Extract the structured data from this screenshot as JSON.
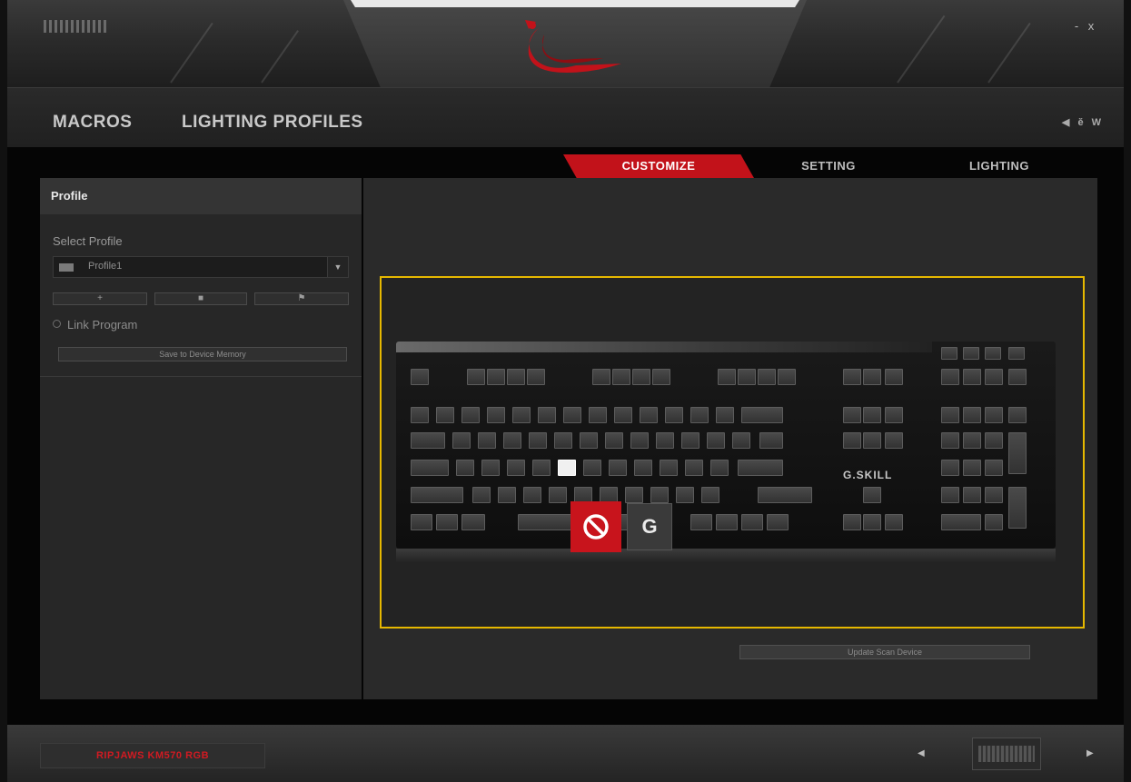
{
  "window": {
    "minimize_label": "-",
    "close_label": "x"
  },
  "nav": {
    "macros": "MACROS",
    "lighting_profiles": "LIGHTING PROFILES",
    "language": "◀ ĕ W"
  },
  "tabs": {
    "customize": "CUSTOMIZE",
    "setting": "SETTING",
    "lighting": "LIGHTING"
  },
  "profile_panel": {
    "title": "Profile",
    "select_label": "Select Profile",
    "selected_profile": "Profile1",
    "add_symbol": "+",
    "import_symbol": "■",
    "delete_symbol": "⚑",
    "link_program_label": "Link Program",
    "save_button": "Save to Device Memory"
  },
  "keyboard": {
    "brand_label": "G.SKILL",
    "popup_g_label": "G"
  },
  "update_button": "Update Scan Device",
  "footer": {
    "device_name": "RIPJAWS KM570 RGB",
    "prev_label": "◀",
    "next_label": "▶"
  },
  "colors": {
    "accent": "#c2121a",
    "highlight_border": "#e6b800"
  }
}
